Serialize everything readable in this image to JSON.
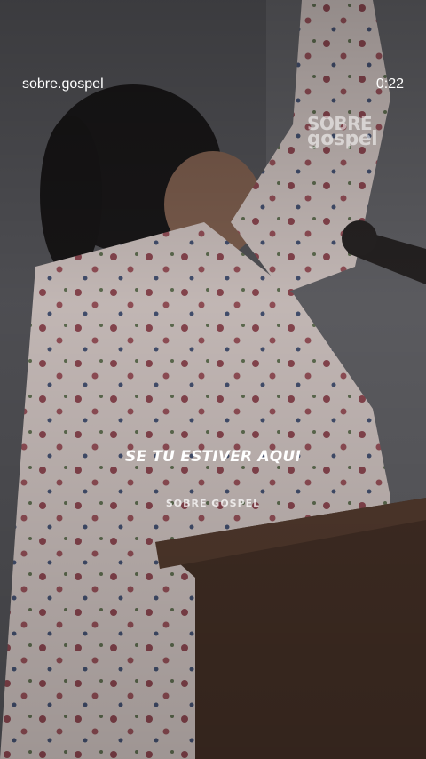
{
  "story": {
    "account_name": "sobre.gospel",
    "timestamp": "0:22"
  },
  "video": {
    "watermark_line1": "SOBRE",
    "watermark_line2": "gospel",
    "caption": "SE TU ESTIVER AQUI",
    "subcaption": "SOBRE GOSPEL"
  },
  "colors": {
    "overlay_text": "#ffffff",
    "background": "#2a2a2c"
  }
}
